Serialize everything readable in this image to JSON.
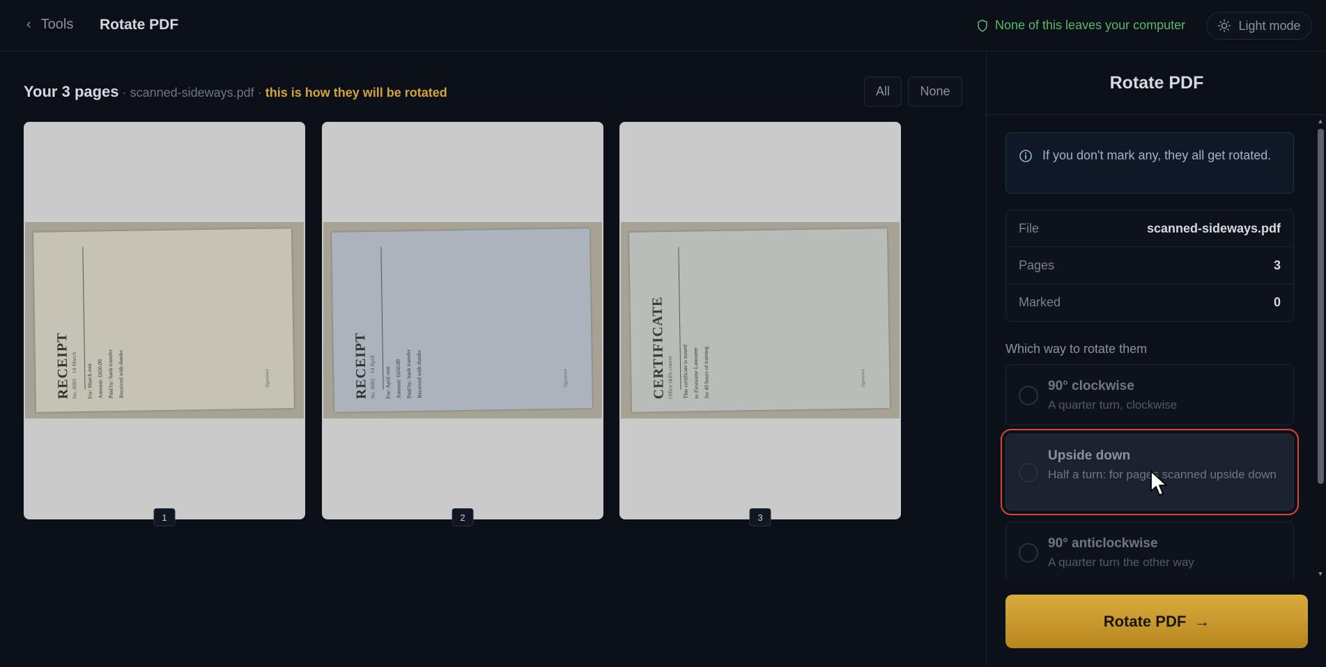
{
  "header": {
    "back_label": "Tools",
    "title": "Rotate PDF",
    "privacy_text": "None of this leaves your computer",
    "theme_toggle_label": "Light mode"
  },
  "main": {
    "heading": "Your 3 pages",
    "separator": "·",
    "filename": "scanned-sideways.pdf",
    "hint": "this is how they will be rotated",
    "select_all_label": "All",
    "select_none_label": "None",
    "pages": [
      {
        "number": "1",
        "doc_title": "RECEIPT",
        "doc_subtitle": "No. 0001 · 14 March",
        "lines": [
          "For: March rent",
          "Amount: £650.00",
          "Paid by: bank transfer",
          "Received with thanks"
        ],
        "signature": "Signature",
        "paper_color": "#c6c2b6"
      },
      {
        "number": "2",
        "doc_title": "RECEIPT",
        "doc_subtitle": "No. 0002 · 14 April",
        "lines": [
          "For: April rent",
          "Amount: £650.00",
          "Paid by: bank transfer",
          "Received with thanks"
        ],
        "signature": "Signature",
        "paper_color": "#abb3bd"
      },
      {
        "number": "3",
        "doc_title": "CERTIFICATE",
        "doc_subtitle": "Office skills course",
        "lines": [
          "This certificate is issued",
          "to Firstname Lastname",
          "for 40 hours of training"
        ],
        "signature": "Signature",
        "paper_color": "#b9bdb9"
      }
    ]
  },
  "panel": {
    "title": "Rotate PDF",
    "info_text": "If you don't mark any, they all get rotated.",
    "stats": [
      {
        "key": "File",
        "value": "scanned-sideways.pdf"
      },
      {
        "key": "Pages",
        "value": "3"
      },
      {
        "key": "Marked",
        "value": "0"
      }
    ],
    "question": "Which way to rotate them",
    "options": [
      {
        "title": "90° clockwise",
        "desc": "A quarter turn, clockwise"
      },
      {
        "title": "Upside down",
        "desc": "Half a turn: for pages scanned upside down"
      },
      {
        "title": "90° anticlockwise",
        "desc": "A quarter turn the other way"
      }
    ],
    "submit_label": "Rotate PDF",
    "submit_arrow": "→"
  },
  "colors": {
    "accent": "#d4a43a",
    "privacy_green": "#5cb86a",
    "highlight_red": "#e0443a",
    "background": "#0b0f17"
  },
  "icons": {
    "back": "chevron-left-icon",
    "privacy": "shield-icon",
    "theme": "sun-icon",
    "info": "info-icon",
    "submit": "arrow-right-icon"
  }
}
